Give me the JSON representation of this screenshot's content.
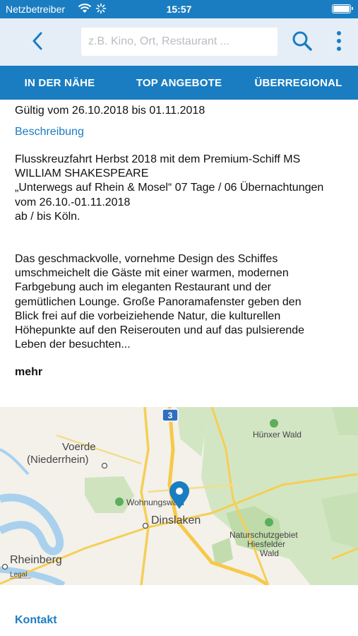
{
  "status": {
    "carrier": "Netzbetreiber",
    "time": "15:57"
  },
  "search": {
    "placeholder": "z.B. Kino, Ort, Restaurant ..."
  },
  "tabs": [
    {
      "label": "IN DER NÄHE"
    },
    {
      "label": "TOP ANGEBOTE"
    },
    {
      "label": "ÜBERREGIONAL"
    }
  ],
  "offer": {
    "validity": "Gültig vom 26.10.2018 bis 01.11.2018",
    "description_heading": "Beschreibung",
    "paragraph1": "Flusskreuzfahrt Herbst 2018 mit dem Premium-Schiff MS\nWILLIAM SHAKESPEARE\n„Unterwegs auf Rhein & Mosel“ 07 Tage / 06 Übernachtungen\nvom 26.10.-01.11.2018\nab / bis Köln.",
    "paragraph2": "Das geschmackvolle, vornehme Design des Schiffes\numschmeichelt die Gäste mit einer warmen, modernen\nFarbgebung auch im eleganten Restaurant und der\ngemütlichen Lounge. Große Panoramafenster geben den\nBlick frei auf die vorbeiziehende Natur, die kulturellen\nHöhepunkte auf den Reiserouten und auf das pulsierende\nLeben der besuchten...",
    "more_label": "mehr",
    "contact_heading": "Kontakt"
  },
  "map": {
    "labels": {
      "voerde_1": "Voerde",
      "voerde_2": "(Niederrhein)",
      "huenxer_wald": "Hünxer Wald",
      "wohnungswald": "Wohnungswald",
      "dinslaken": "Dinslaken",
      "nsg_1": "Naturschutzgebiet",
      "nsg_2": "Hiesfelder",
      "nsg_3": "Wald",
      "rheinberg": "Rheinberg",
      "legal": "Legal",
      "road_shield": "3"
    }
  },
  "colors": {
    "accent": "#1a7dc1",
    "header_bg": "#e5eef7"
  },
  "icons": {
    "back": "chevron-left",
    "search": "magnifier",
    "more": "vertical-dots",
    "pin": "map-pin"
  }
}
